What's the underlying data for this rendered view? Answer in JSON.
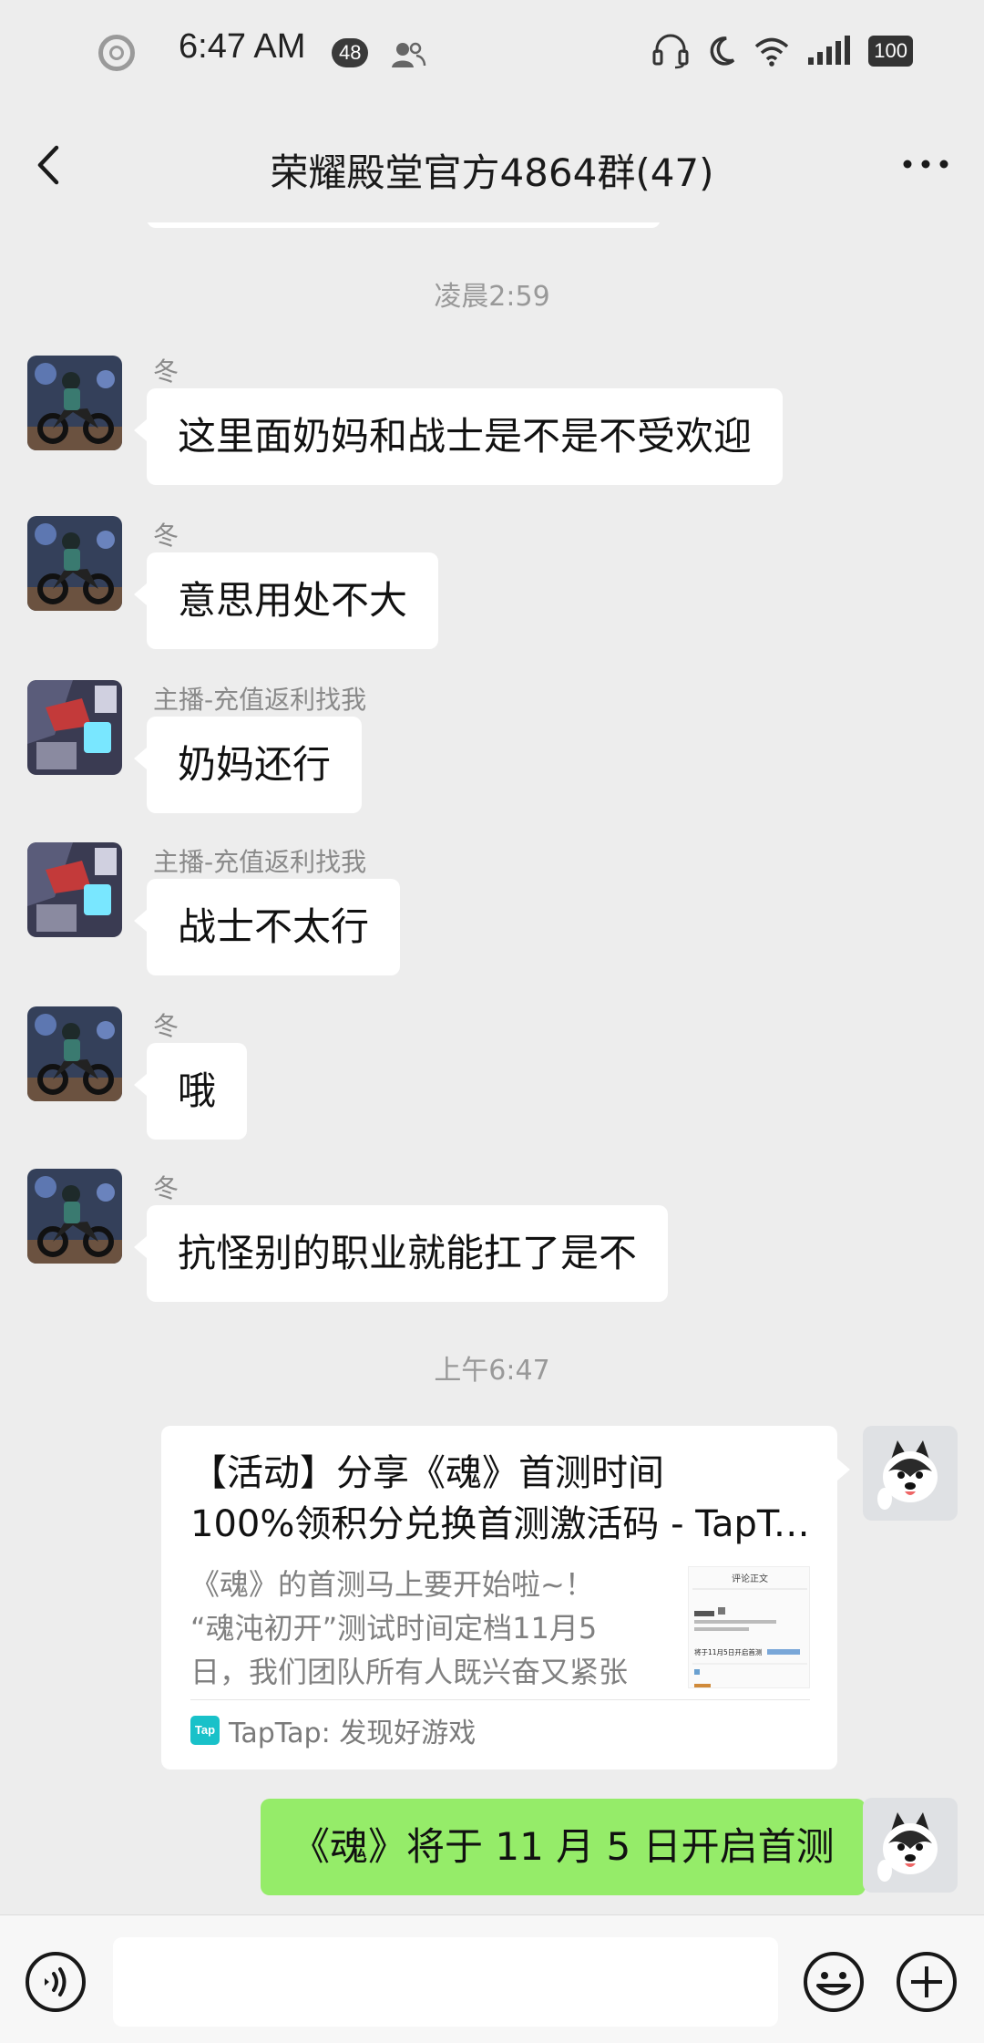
{
  "status_bar": {
    "time": "6:47 AM",
    "notification_count": "48",
    "battery": "100"
  },
  "header": {
    "title": "荣耀殿堂官方4864群(47)"
  },
  "timestamps": [
    "凌晨2:59",
    "上午6:47"
  ],
  "messages": [
    {
      "sender": "冬",
      "text": "这里面奶妈和战士是不是不受欢迎"
    },
    {
      "sender": "冬",
      "text": "意思用处不大"
    },
    {
      "sender": "主播-充值返利找我",
      "text": "奶妈还行"
    },
    {
      "sender": "主播-充值返利找我",
      "text": "战士不太行"
    },
    {
      "sender": "冬",
      "text": "哦"
    },
    {
      "sender": "冬",
      "text": "抗怪别的职业就能扛了是不"
    }
  ],
  "link_card": {
    "title_line1": "【活动】分享《魂》首测时间",
    "title_line2": "100%领积分兑换首测激活码 - TapTap",
    "desc_line1": "《魂》的首测马上要开始啦~！",
    "desc_line2": "“魂沌初开”测试时间定档11月5",
    "desc_line3": "日，我们团队所有人既兴奋又紧张",
    "thumb_header": "评论正文",
    "thumb_line": "将于11月5日开启首测",
    "source": "TapTap: 发现好游戏"
  },
  "my_message": {
    "text": "《魂》将于 11 月 5 日开启首测"
  },
  "input": {
    "placeholder": ""
  },
  "colors": {
    "background": "#ededed",
    "incoming_bubble": "#ffffff",
    "outgoing_bubble": "#95ec69",
    "taptap_brand": "#19c1c9"
  },
  "icons": {
    "back": "chevron-left-icon",
    "more": "more-dots-icon",
    "voice": "voice-icon",
    "emoji": "emoji-icon",
    "plus": "plus-icon"
  }
}
